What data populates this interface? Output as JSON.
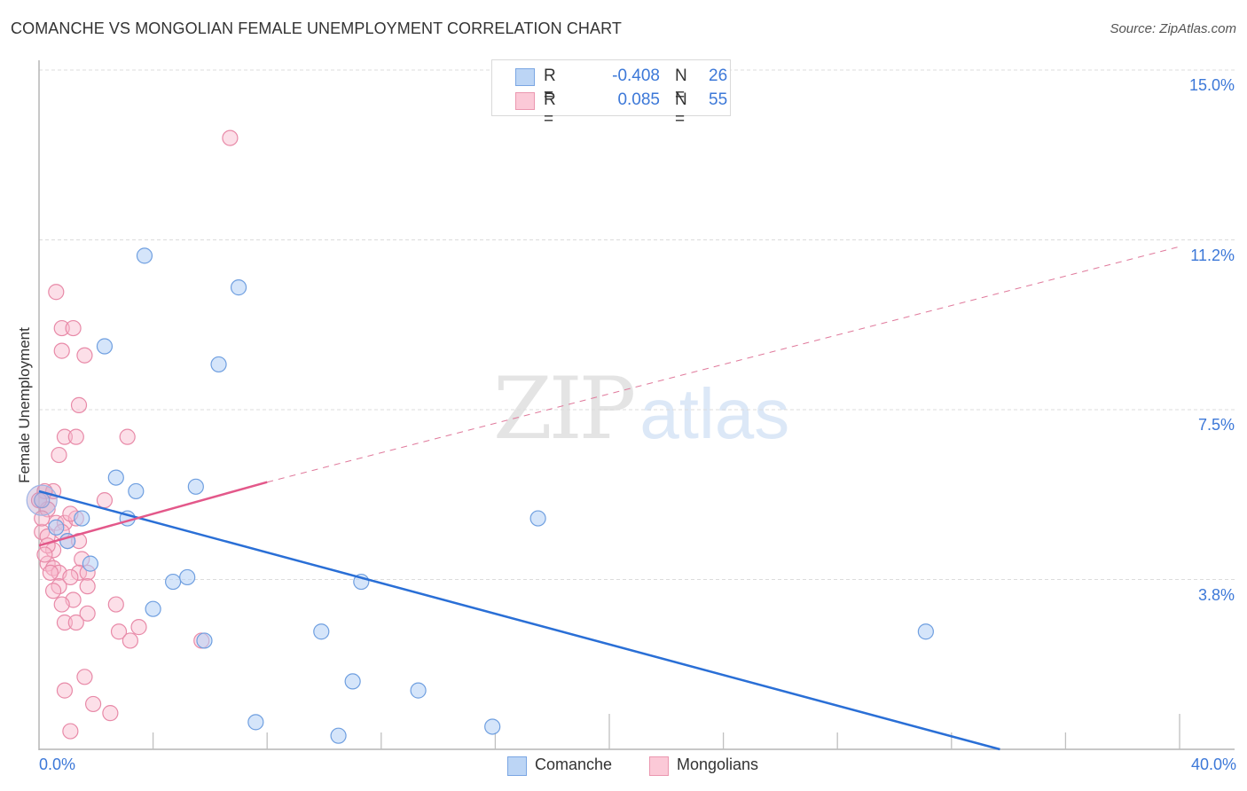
{
  "header": {
    "title": "COMANCHE VS MONGOLIAN FEMALE UNEMPLOYMENT CORRELATION CHART",
    "source": "Source: ZipAtlas.com"
  },
  "watermark": {
    "zip": "ZIP",
    "atlas": "atlas"
  },
  "legend": {
    "rows": [
      {
        "r_label": "R =",
        "r_value": "-0.408",
        "n_label": "N =",
        "n_value": "26",
        "color": "#a9c8f0"
      },
      {
        "r_label": "R =",
        "r_value": "0.085",
        "n_label": "N =",
        "n_value": "55",
        "color": "#f7b6c8"
      }
    ]
  },
  "bottom_legend": [
    {
      "label": "Comanche"
    },
    {
      "label": "Mongolians"
    }
  ],
  "chart_data": {
    "type": "scatter",
    "title": "COMANCHE VS MONGOLIAN FEMALE UNEMPLOYMENT CORRELATION CHART",
    "xlabel": "",
    "ylabel": "Female Unemployment",
    "xlim": [
      0,
      40
    ],
    "ylim": [
      0,
      15
    ],
    "x_tick_labels": [
      "0.0%",
      "40.0%"
    ],
    "y_tick_labels": [
      "15.0%",
      "11.2%",
      "7.5%",
      "3.8%"
    ],
    "y_ticks": [
      15.0,
      11.25,
      7.5,
      3.75
    ],
    "grid": true,
    "legend_position": "top-center",
    "colors": {
      "Comanche": "#3c78d8",
      "Mongolians": "#e8648f"
    },
    "series": [
      {
        "name": "Comanche",
        "r": -0.408,
        "n": 26,
        "trend": {
          "x": [
            0,
            33.7
          ],
          "y": [
            5.7,
            0.0
          ],
          "dashed_extension": false
        },
        "points": [
          [
            3.7,
            10.9
          ],
          [
            7.0,
            10.2
          ],
          [
            2.3,
            8.9
          ],
          [
            6.3,
            8.5
          ],
          [
            2.7,
            6.0
          ],
          [
            3.4,
            5.7
          ],
          [
            5.5,
            5.8
          ],
          [
            3.1,
            5.1
          ],
          [
            1.5,
            5.1
          ],
          [
            17.5,
            5.1
          ],
          [
            0.6,
            4.9
          ],
          [
            1.0,
            4.6
          ],
          [
            1.8,
            4.1
          ],
          [
            4.7,
            3.7
          ],
          [
            5.2,
            3.8
          ],
          [
            11.3,
            3.7
          ],
          [
            4.0,
            3.1
          ],
          [
            5.8,
            2.4
          ],
          [
            9.9,
            2.6
          ],
          [
            31.1,
            2.6
          ],
          [
            11.0,
            1.5
          ],
          [
            13.3,
            1.3
          ],
          [
            7.6,
            0.6
          ],
          [
            10.5,
            0.3
          ],
          [
            15.9,
            0.5
          ],
          [
            0.1,
            5.5
          ]
        ]
      },
      {
        "name": "Mongolians",
        "r": 0.085,
        "n": 55,
        "trend": {
          "x": [
            0,
            8.0
          ],
          "y": [
            4.5,
            5.9
          ],
          "dashed_extension_to": [
            40,
            11.1
          ]
        },
        "points": [
          [
            6.7,
            13.5
          ],
          [
            0.6,
            10.1
          ],
          [
            0.8,
            9.3
          ],
          [
            1.2,
            9.3
          ],
          [
            0.8,
            8.8
          ],
          [
            1.6,
            8.7
          ],
          [
            1.4,
            7.6
          ],
          [
            0.9,
            6.9
          ],
          [
            1.3,
            6.9
          ],
          [
            3.1,
            6.9
          ],
          [
            0.7,
            6.5
          ],
          [
            2.3,
            5.5
          ],
          [
            0.5,
            5.7
          ],
          [
            0.2,
            5.7
          ],
          [
            0.6,
            5.0
          ],
          [
            0.9,
            5.0
          ],
          [
            1.3,
            5.1
          ],
          [
            0.1,
            4.8
          ],
          [
            0.3,
            4.7
          ],
          [
            1.0,
            4.6
          ],
          [
            0.5,
            4.4
          ],
          [
            1.5,
            4.2
          ],
          [
            0.3,
            4.1
          ],
          [
            0.5,
            4.0
          ],
          [
            0.7,
            3.9
          ],
          [
            1.4,
            3.9
          ],
          [
            1.7,
            3.9
          ],
          [
            1.1,
            3.8
          ],
          [
            0.7,
            3.6
          ],
          [
            1.7,
            3.6
          ],
          [
            1.2,
            3.3
          ],
          [
            0.8,
            3.2
          ],
          [
            1.7,
            3.0
          ],
          [
            2.7,
            3.2
          ],
          [
            0.9,
            2.8
          ],
          [
            1.3,
            2.8
          ],
          [
            3.5,
            2.7
          ],
          [
            2.8,
            2.6
          ],
          [
            3.2,
            2.4
          ],
          [
            5.7,
            2.4
          ],
          [
            0.9,
            1.3
          ],
          [
            1.6,
            1.6
          ],
          [
            1.9,
            1.0
          ],
          [
            2.5,
            0.8
          ],
          [
            1.1,
            0.4
          ],
          [
            0.3,
            5.3
          ],
          [
            0.1,
            5.1
          ],
          [
            0.3,
            4.5
          ],
          [
            0.5,
            3.5
          ],
          [
            1.4,
            4.6
          ],
          [
            0.8,
            4.8
          ],
          [
            0.2,
            4.3
          ],
          [
            0.4,
            3.9
          ],
          [
            1.1,
            5.2
          ],
          [
            0.0,
            5.5
          ]
        ]
      }
    ]
  }
}
